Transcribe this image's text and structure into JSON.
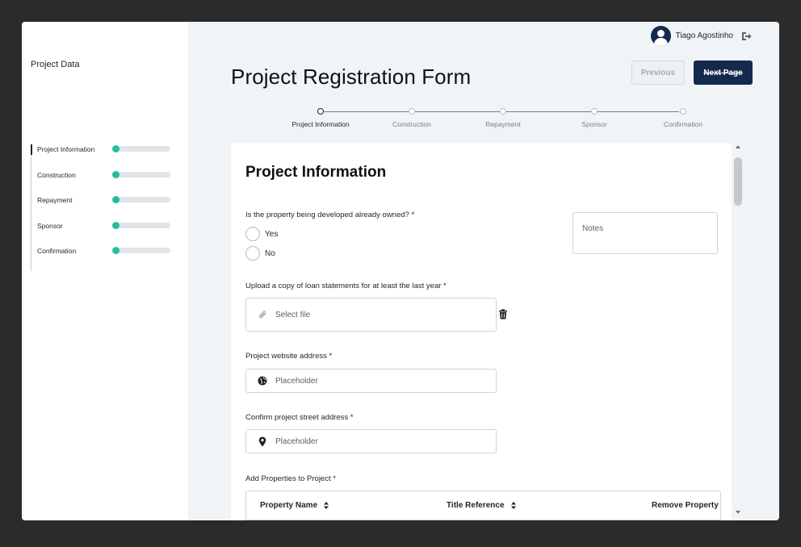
{
  "user": {
    "name": "Tiago Agostinho"
  },
  "sidebar": {
    "title": "Project Data",
    "items": [
      {
        "label": "Project Information",
        "progress": 0.05
      },
      {
        "label": "Construction",
        "progress": 0.05
      },
      {
        "label": "Repayment",
        "progress": 0.05
      },
      {
        "label": "Sponsor",
        "progress": 0.05
      },
      {
        "label": "Confirmation",
        "progress": 0.05
      }
    ]
  },
  "header": {
    "title": "Project Registration Form",
    "previous_label": "Previous",
    "next_label": "Next Page"
  },
  "stepper": {
    "steps": [
      "Project Information",
      "Construction",
      "Repayment",
      "Sponsor",
      "Confirmation"
    ],
    "active_index": 0
  },
  "form": {
    "section_title": "Project Information",
    "owned_question": "Is the property being developed already owned? *",
    "options": [
      "Yes",
      "No"
    ],
    "notes_label": "Notes",
    "upload_label": "Upload a copy of loan statements for at least the last year *",
    "upload_placeholder": "Select file",
    "website_label": "Project website address *",
    "website_placeholder": "Placeholder",
    "street_label": "Confirm project street address *",
    "street_placeholder": "Placeholder",
    "properties_label": "Add Properties to Project *",
    "table_headers": [
      "Property Name",
      "Title Reference",
      "Remove Property"
    ]
  },
  "colors": {
    "primary": "#14294d",
    "accent": "#21bfa0",
    "background": "#f1f4f7"
  }
}
